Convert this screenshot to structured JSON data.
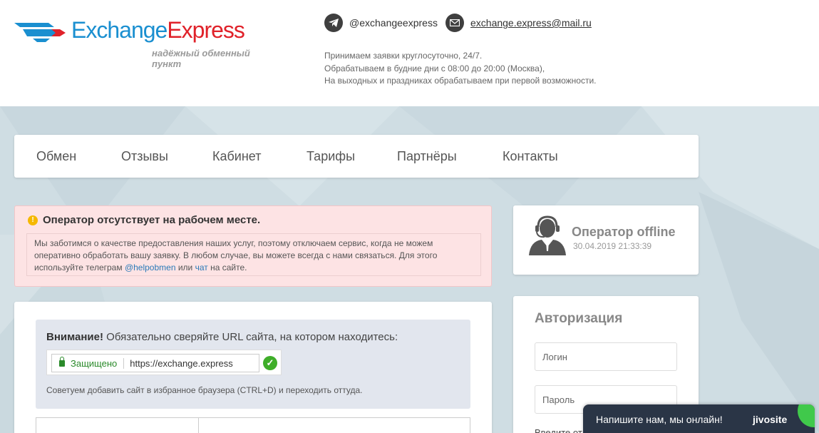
{
  "header": {
    "logo": {
      "part1": "Exchange",
      "part2": "Express",
      "tagline": "надёжный обменный пункт"
    },
    "telegram": "@exchangeexpress",
    "email": "exchange.express@mail.ru",
    "hours": [
      "Принимаем заявки круглосуточно, 24/7.",
      "Обрабатываем в будние дни с 08:00 до 20:00 (Москва),",
      "На выходных и праздниках обрабатываем при первой возможности."
    ]
  },
  "nav": {
    "items": [
      "Обмен",
      "Отзывы",
      "Кабинет",
      "Тарифы",
      "Партнёры",
      "Контакты"
    ]
  },
  "alert": {
    "title": "Оператор отсутствует на рабочем месте.",
    "body_before": "Мы заботимся о качестве предоставления наших услуг, поэтому отключаем сервис, когда не можем оперативно обработать вашу заявку. В любом случае, вы можете всегда с нами связаться. Для этого используйте телеграм ",
    "link1": "@helpobmen",
    "body_mid": " или ",
    "link2": "чат",
    "body_after": " на сайте."
  },
  "operator": {
    "status": "Оператор offline",
    "datetime": "30.04.2019 21:33:39"
  },
  "notice": {
    "title_bold": "Внимание!",
    "title_rest": " Обязательно сверяйте URL сайта, на котором находитесь:",
    "secure_label": "Защищено",
    "url": "https://exchange.express",
    "footer": "Советуем добавить сайт в избранное браузера (CTRL+D) и переходить оттуда."
  },
  "auth": {
    "title": "Авторизация",
    "login_placeholder": "Логин",
    "password_placeholder": "Пароль",
    "cut_text": "Введите от"
  },
  "chat": {
    "text": "Напишите нам, мы онлайн!",
    "brand": "jivosite"
  },
  "colors": {
    "brand_blue": "#1a8fd0",
    "brand_red": "#e0222a",
    "alert_bg": "#fde3e4",
    "chat_bg": "#2a3546",
    "chat_accent": "#40c94b"
  }
}
